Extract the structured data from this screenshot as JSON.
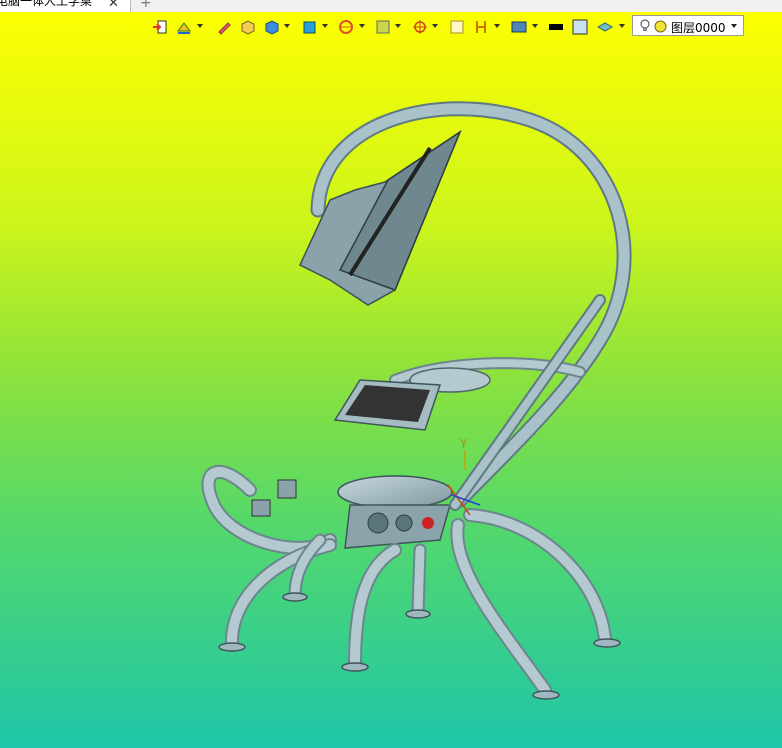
{
  "tab": {
    "title": "电脑一体人工学桌",
    "close_symbol": "✕",
    "add_symbol": "+"
  },
  "toolbar": {
    "icons": [
      "exit-sketch-icon",
      "sketch-icon",
      "pencil-icon",
      "box-icon",
      "solid-cube-icon",
      "view-cube-icon",
      "render-icon",
      "section-icon",
      "snap-icon",
      "frame-icon",
      "dimension-icon",
      "display-icon",
      "color-swatch-icon",
      "fill-swatch-icon",
      "layers-icon"
    ],
    "layer": {
      "name": "图层0000"
    }
  },
  "viewport": {
    "background_top": "#ffff00",
    "background_bottom": "#1fc6a9",
    "model_color": "#9fb8c0",
    "axis_label": "Y"
  }
}
